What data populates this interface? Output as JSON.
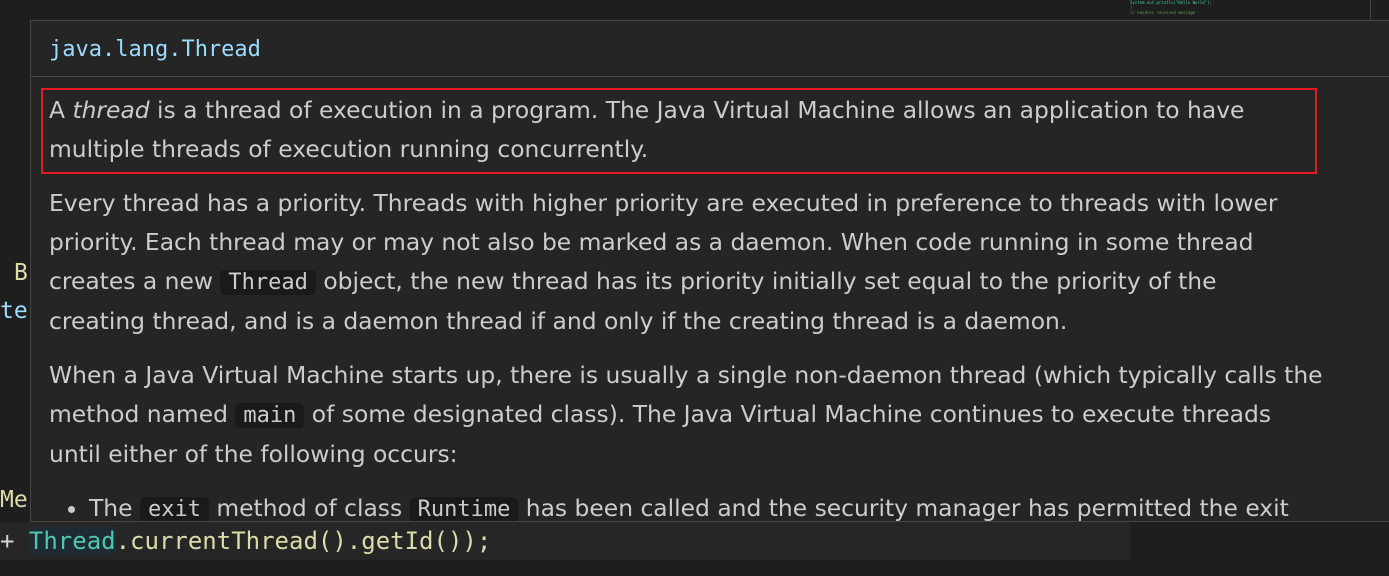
{
  "editor": {
    "fragments": {
      "b": "B",
      "te": "te",
      "me": "Me"
    },
    "code_line": {
      "prefix": "+ ",
      "class_token": "Thread",
      "rest": ".currentThread().getId());"
    },
    "minimap": [
      "  System.out.println(\"Hello World\");",
      "}",
      "// handles received message"
    ]
  },
  "hover": {
    "signature": "java.lang.Thread",
    "p1": {
      "a": "A ",
      "em": "thread",
      "b": " is a thread of execution in a program. The Java Virtual Machine allows an application to have",
      "line2": "multiple threads of execution running concurrently."
    },
    "p2": {
      "l1": "Every thread has a priority. Threads with higher priority are executed in preference to threads with lower",
      "l2": "priority. Each thread may or may not also be marked as a daemon. When code running in some thread",
      "l3a": "creates a new ",
      "l3code": "Thread",
      "l3b": " object, the new thread has its priority initially set equal to the priority of the",
      "l4": "creating thread, and is a daemon thread if and only if the creating thread is a daemon."
    },
    "p3": {
      "l1": "When a Java Virtual Machine starts up, there is usually a single non-daemon thread (which typically calls the",
      "l2a": "method named ",
      "l2code": "main",
      "l2b": " of some designated class). The Java Virtual Machine continues to execute threads",
      "l3": "until either of the following occurs:"
    },
    "bullet1": {
      "a": "The ",
      "code1": "exit",
      "b": " method of class ",
      "code2": "Runtime",
      "c": " has been called and the security manager has permitted the exit"
    },
    "highlight_color": "#e51a24"
  }
}
